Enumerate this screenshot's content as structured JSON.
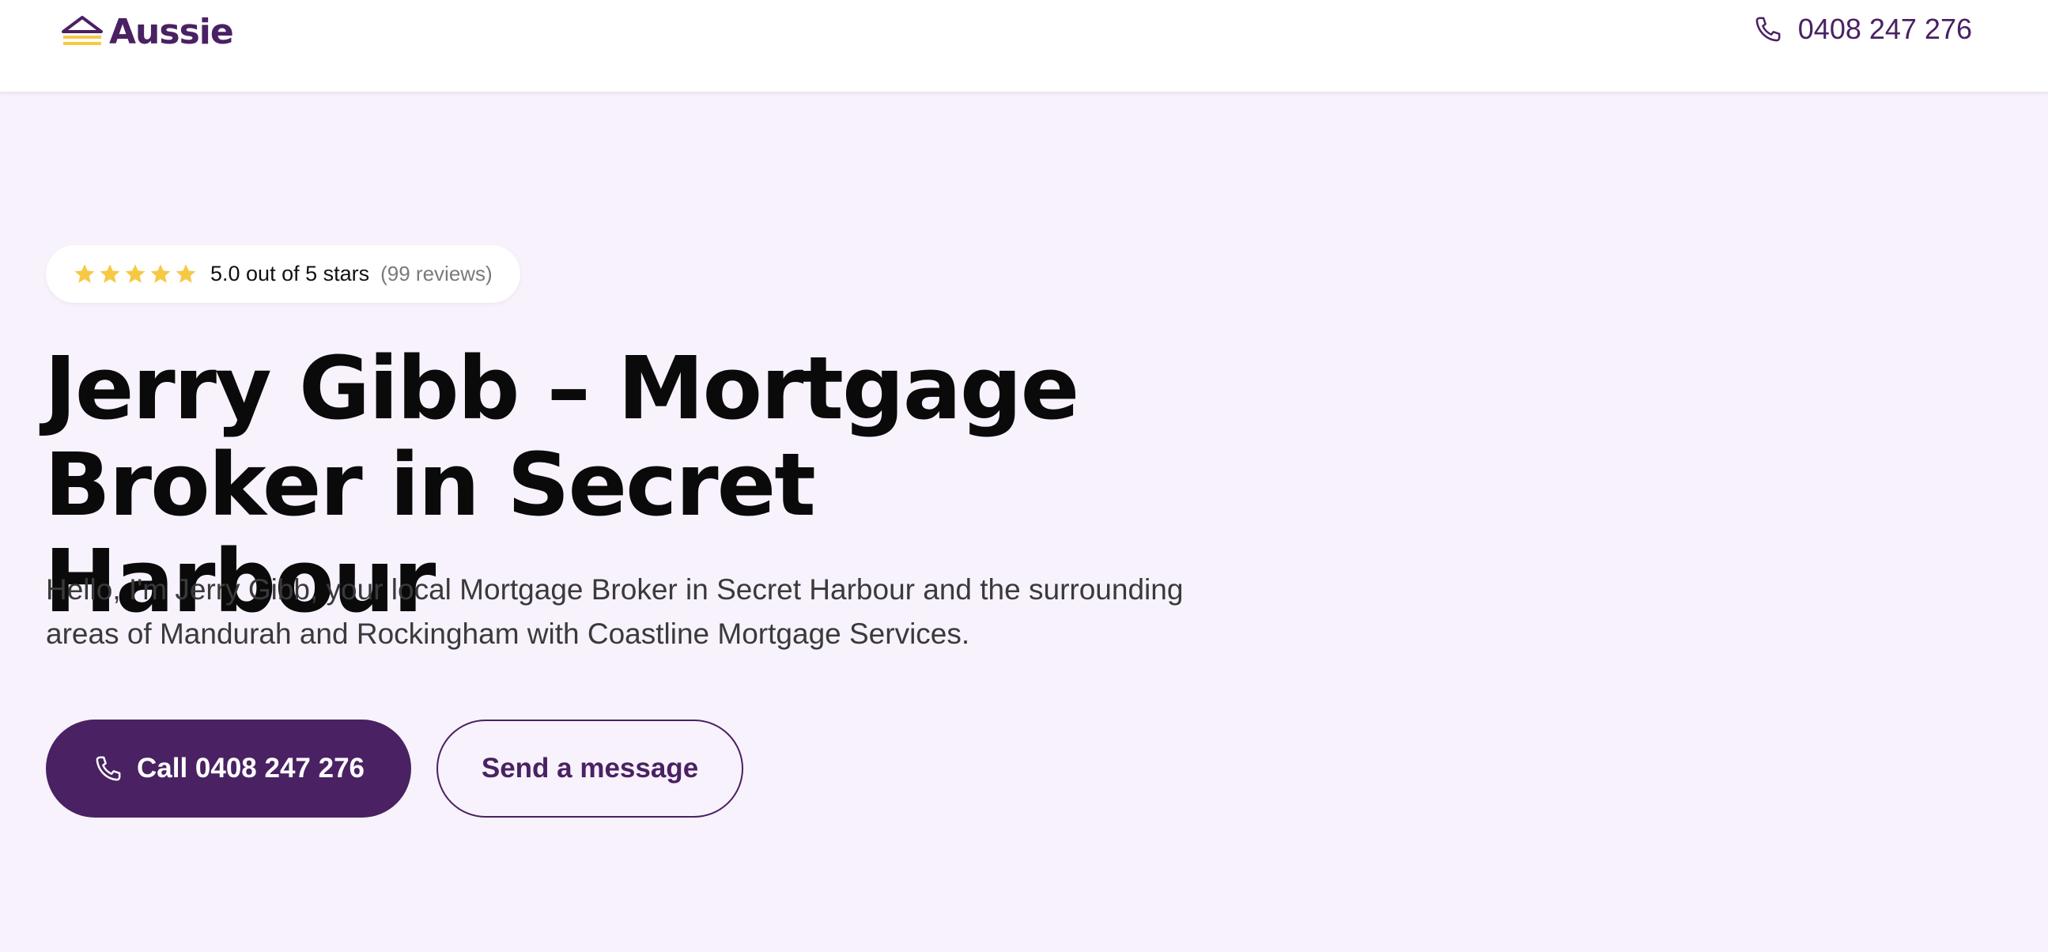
{
  "colors": {
    "brand": "#4a2163",
    "star": "#f6c945",
    "page_background": "#f7f2fc"
  },
  "header": {
    "logo_text": "Aussie",
    "logo_icon": "house-roof-icon",
    "phone_icon": "phone-icon",
    "phone_number": "0408 247 276"
  },
  "rating": {
    "stars": 5,
    "star_icon": "star-icon",
    "text": "5.0 out of 5 stars",
    "reviews": "(99 reviews)"
  },
  "hero": {
    "headline_line1": "Jerry Gibb – Mortgage",
    "headline_line2": "Broker in Secret Harbour",
    "intro_line1": "Hello, I'm Jerry Gibb, your local Mortgage Broker in Secret Harbour and the surrounding",
    "intro_line2": "areas of Mandurah and Rockingham with Coastline Mortgage Services."
  },
  "actions": {
    "call_label": "Call 0408 247 276",
    "call_icon": "phone-icon",
    "message_label": "Send a message"
  }
}
